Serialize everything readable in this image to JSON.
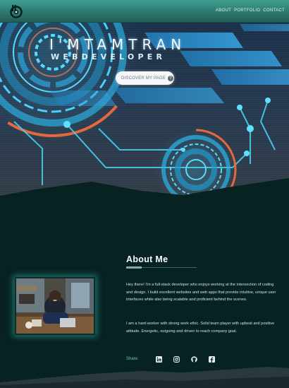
{
  "nav": {
    "links": [
      "ABOUT",
      "PORTFOLIO",
      "CONTACT"
    ]
  },
  "hero": {
    "title": "I'MTAMTRAN",
    "subtitle": "WEBDEVELOPER",
    "cta_label": "DISCOVER MY PAGE",
    "cta_icon": "?"
  },
  "about": {
    "heading": "About Me",
    "paragraph1": "Hey there! I'm a full-stack developer who enjoys working at the intersection of coding and design. I build excellent websites and web apps that provide intuitive, unique user interfaces while also being scalable and proficient behind the scenes.",
    "paragraph2": "I am a hard-worker with strong work ethic. Solid team player with upbeat and positive attitude. Energetic, outgoing and driven to reach company goal.",
    "share_label": "Share:",
    "socials": [
      "linkedin-icon",
      "instagram-icon",
      "github-icon",
      "facebook-icon"
    ]
  },
  "colors": {
    "nav": "#2f8078",
    "background": "#062221",
    "accent": "#72c8c0",
    "hero_cyan": "#38c8ee",
    "hero_orange": "#e8663a"
  }
}
